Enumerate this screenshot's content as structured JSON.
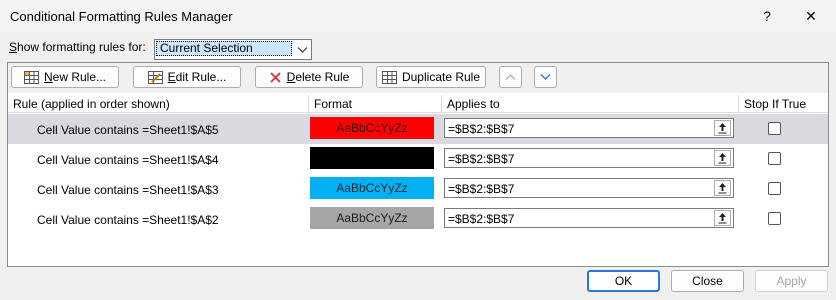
{
  "window": {
    "title": "Conditional Formatting Rules Manager",
    "help_glyph": "?",
    "close_glyph": "✕"
  },
  "show_rules": {
    "label": "Show formatting rules for:",
    "selected": "Current Selection"
  },
  "toolbar": {
    "new_rule": "New Rule...",
    "edit_rule": "Edit Rule...",
    "delete_rule": "Delete Rule",
    "duplicate_rule": "Duplicate Rule"
  },
  "columns": {
    "rule": "Rule (applied in order shown)",
    "format": "Format",
    "applies_to": "Applies to",
    "stop_if_true": "Stop If True"
  },
  "rules": [
    {
      "rule": "Cell Value contains =Sheet1!$A$5",
      "preview": "AaBbCcYyZz",
      "fill": "#ff0000",
      "text_color": "#3a0000",
      "applies_to": "=$B$2:$B$7",
      "stop_if_true": false,
      "selected": true
    },
    {
      "rule": "Cell Value contains =Sheet1!$A$4",
      "preview": "",
      "fill": "#000000",
      "text_color": "#000000",
      "applies_to": "=$B$2:$B$7",
      "stop_if_true": false,
      "selected": false
    },
    {
      "rule": "Cell Value contains =Sheet1!$A$3",
      "preview": "AaBbCcYyZz",
      "fill": "#00b0f0",
      "text_color": "#0a2a3a",
      "applies_to": "=$B$2:$B$7",
      "stop_if_true": false,
      "selected": false
    },
    {
      "rule": "Cell Value contains =Sheet1!$A$2",
      "preview": "AaBbCcYyZz",
      "fill": "#a6a6a6",
      "text_color": "#1a1a1a",
      "applies_to": "=$B$2:$B$7",
      "stop_if_true": false,
      "selected": false
    }
  ],
  "footer": {
    "ok": "OK",
    "close": "Close",
    "apply": "Apply"
  },
  "colors": {
    "ok_border": "#2b78d6",
    "selected_row": "#d9d9df",
    "move_arrow": "#2b78d6"
  }
}
